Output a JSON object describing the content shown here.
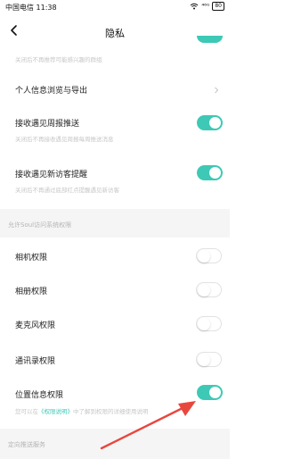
{
  "status": {
    "carrier_time": "中国电信 11:38",
    "signal_text": "⁴⁶ᴳ",
    "battery": "80"
  },
  "nav": {
    "title": "隐私"
  },
  "items": {
    "recommend_desc": "关闭后不再推荐可能感兴趣的群组",
    "personal_info_label": "个人信息浏览与导出",
    "weekly_label": "接收遇见周报推送",
    "weekly_desc": "关闭后不再接收遇见周报每周推送消息",
    "visitor_label": "接收遇见新访客提醒",
    "visitor_desc": "关闭后不再通过底部红点提醒遇见新访客",
    "camera_label": "相机权限",
    "album_label": "相册权限",
    "mic_label": "麦克风权限",
    "contacts_label": "通讯录权限",
    "location_label": "位置信息权限",
    "location_desc_prefix": "您可以在",
    "location_desc_link": "《权限说明》",
    "location_desc_suffix": "中了解到权限的详细使用说明"
  },
  "sections": {
    "permissions_title": "允许Soul访问系统权限",
    "push_title": "定向推送服务"
  },
  "toggles": {
    "recommend": true,
    "weekly": true,
    "visitor": true,
    "camera": false,
    "album": false,
    "mic": false,
    "contacts": false,
    "location": true
  },
  "colors": {
    "accent": "#3dc9b6",
    "annotation_arrow": "#e8473e"
  }
}
